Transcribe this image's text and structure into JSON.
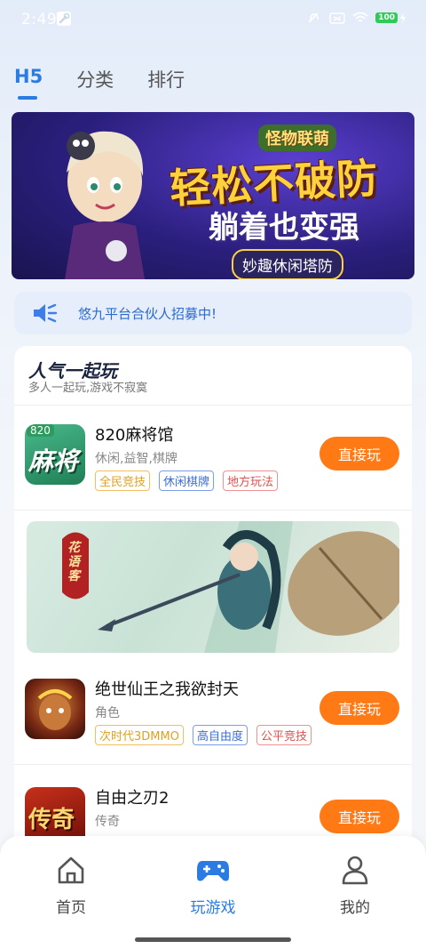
{
  "status": {
    "time": "2:49",
    "battery": "100"
  },
  "tabs": [
    {
      "label": "H5"
    },
    {
      "label": "分类"
    },
    {
      "label": "排行"
    }
  ],
  "banner": {
    "logo": "怪物联萌",
    "title": "轻松不破防",
    "subtitle": "躺着也变强",
    "tagline": "妙趣休闲塔防"
  },
  "notice": {
    "text": "悠九平台合伙人招募中!"
  },
  "section": {
    "title": "人气一起玩",
    "subtitle": "多人一起玩,游戏不寂寞"
  },
  "games": [
    {
      "name": "820麻将馆",
      "category": "休闲,益智,棋牌",
      "tags": [
        "全民竞技",
        "休闲棋牌",
        "地方玩法"
      ],
      "button": "直接玩",
      "icon_text": "麻将",
      "icon_badge": "820"
    },
    {
      "name": "绝世仙王之我欲封天",
      "category": "角色",
      "tags": [
        "次时代3DMMO",
        "高自由度",
        "公平竞技"
      ],
      "button": "直接玩"
    },
    {
      "name": "自由之刃2",
      "category": "传奇",
      "tags": [],
      "button": "直接玩",
      "icon_text": "传奇"
    }
  ],
  "promo": {
    "logo": "花语客"
  },
  "bottom_nav": [
    {
      "label": "首页"
    },
    {
      "label": "玩游戏"
    },
    {
      "label": "我的"
    }
  ],
  "colors": {
    "accent": "#2a7be4",
    "button": "#ff7a14"
  }
}
